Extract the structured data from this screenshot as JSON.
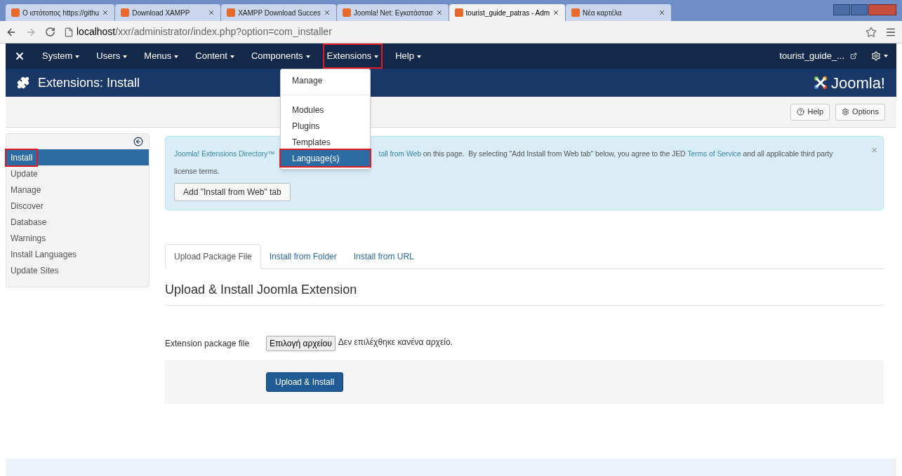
{
  "browser": {
    "tabs": [
      {
        "title": "Ο ιστότοπος https://githu",
        "selected": false
      },
      {
        "title": "Download XAMPP",
        "selected": false
      },
      {
        "title": "XAMPP Download Succes",
        "selected": false
      },
      {
        "title": "Joomla! Net: Εγκατάστασ",
        "selected": false
      },
      {
        "title": "tourist_guide_patras - Adm",
        "selected": true
      },
      {
        "title": "Νέα καρτέλα",
        "selected": false
      }
    ],
    "url_host": "localhost",
    "url_path": "/xxr/administrator/index.php?option=com_installer"
  },
  "navbar": {
    "menus": [
      {
        "label": "System",
        "marked": false
      },
      {
        "label": "Users",
        "marked": false
      },
      {
        "label": "Menus",
        "marked": false
      },
      {
        "label": "Content",
        "marked": false
      },
      {
        "label": "Components",
        "marked": false
      },
      {
        "label": "Extensions",
        "marked": true
      },
      {
        "label": "Help",
        "marked": false
      }
    ],
    "site": "tourist_guide_..."
  },
  "dropdown": {
    "items": [
      {
        "label": "Manage",
        "selected": false,
        "marked": false,
        "divider_after": true
      },
      {
        "label": "Modules",
        "selected": false,
        "marked": false,
        "divider_after": false
      },
      {
        "label": "Plugins",
        "selected": false,
        "marked": false,
        "divider_after": false
      },
      {
        "label": "Templates",
        "selected": false,
        "marked": false,
        "divider_after": false
      },
      {
        "label": "Language(s)",
        "selected": true,
        "marked": true,
        "divider_after": false
      }
    ]
  },
  "header": {
    "title": "Extensions: Install",
    "logo_text": "Joomla!"
  },
  "toolbar": {
    "buttons": [
      "Help",
      "Options"
    ]
  },
  "sidebar": {
    "items": [
      {
        "label": "Install",
        "selected": true,
        "marked": true
      },
      {
        "label": "Update",
        "selected": false,
        "marked": false
      },
      {
        "label": "Manage",
        "selected": false,
        "marked": false
      },
      {
        "label": "Discover",
        "selected": false,
        "marked": false
      },
      {
        "label": "Database",
        "selected": false,
        "marked": false
      },
      {
        "label": "Warnings",
        "selected": false,
        "marked": false
      },
      {
        "label": "Install Languages",
        "selected": false,
        "marked": false
      },
      {
        "label": "Update Sites",
        "selected": false,
        "marked": false
      }
    ]
  },
  "alert": {
    "text_start": "Joomla! Extensions Directory™",
    "link_fragment": "tall from Web",
    "text_middle": " on this page.  By selecting \"Add Install from Web tab\" below, you agree to the JED ",
    "link": "Terms of Service",
    "text_end": " and all applicable third party",
    "text_second_line": "license terms.",
    "button": "Add \"Install from Web\" tab",
    "close": "×"
  },
  "tabs": [
    {
      "label": "Upload Package File",
      "selected": true
    },
    {
      "label": "Install from Folder",
      "selected": false
    },
    {
      "label": "Install from URL",
      "selected": false
    }
  ],
  "form": {
    "heading": "Upload & Install Joomla Extension",
    "label": "Extension package file",
    "file_button": "Επιλογή αρχείου",
    "file_status": "Δεν επιλέχθηκε κανένα αρχείο.",
    "submit": "Upload & Install"
  }
}
